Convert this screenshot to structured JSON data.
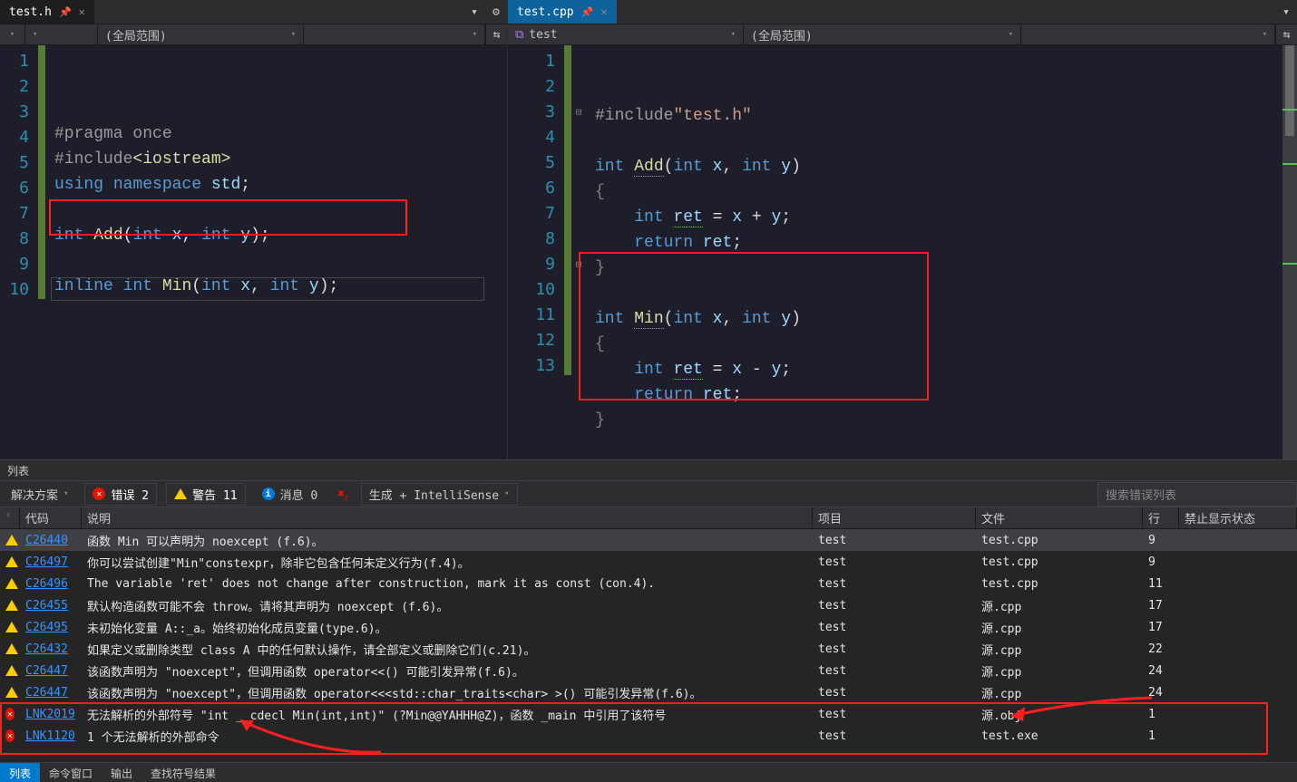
{
  "left_tab": {
    "name": "test.h",
    "pin": "⇲"
  },
  "right_tab": {
    "name": "test.cpp",
    "pin": "⇲"
  },
  "left_nav": {
    "scope": "(全局范围)"
  },
  "right_nav": {
    "proj_icon": "⧉",
    "proj": "test",
    "scope": "(全局范围)"
  },
  "left_code": {
    "lines": [
      {
        "n": "1",
        "tokens": [
          [
            "directive",
            "#pragma once"
          ]
        ]
      },
      {
        "n": "2",
        "tokens": [
          [
            "directive",
            "#include"
          ],
          [
            "ident",
            "<iostream>"
          ]
        ]
      },
      {
        "n": "3",
        "tokens": [
          [
            "kw",
            "using "
          ],
          [
            "kw",
            "namespace "
          ],
          [
            "var",
            "std"
          ],
          [
            "punct",
            ";"
          ]
        ]
      },
      {
        "n": "4",
        "tokens": []
      },
      {
        "n": "5",
        "tokens": [
          [
            "type",
            "int "
          ],
          [
            "ident",
            "Add"
          ],
          [
            "paren",
            "("
          ],
          [
            "type",
            "int "
          ],
          [
            "var",
            "x"
          ],
          [
            "punct",
            ", "
          ],
          [
            "type",
            "int "
          ],
          [
            "var",
            "y"
          ],
          [
            "paren",
            ")"
          ],
          [
            "punct",
            ";"
          ]
        ]
      },
      {
        "n": "6",
        "tokens": []
      },
      {
        "n": "7",
        "tokens": [
          [
            "kw",
            "inline "
          ],
          [
            "type",
            "int "
          ],
          [
            "ident",
            "Min"
          ],
          [
            "paren",
            "("
          ],
          [
            "type",
            "int "
          ],
          [
            "var",
            "x"
          ],
          [
            "punct",
            ", "
          ],
          [
            "type",
            "int "
          ],
          [
            "var",
            "y"
          ],
          [
            "paren",
            ")"
          ],
          [
            "punct",
            ";"
          ]
        ]
      },
      {
        "n": "8",
        "tokens": []
      },
      {
        "n": "9",
        "tokens": []
      },
      {
        "n": "10",
        "tokens": []
      }
    ]
  },
  "right_code": {
    "lines": [
      {
        "n": "1",
        "tokens": [
          [
            "directive",
            "#include"
          ],
          [
            "str",
            "\"test.h\""
          ]
        ]
      },
      {
        "n": "2",
        "tokens": []
      },
      {
        "n": "3",
        "fold": "⊟",
        "tokens": [
          [
            "type",
            "int "
          ],
          [
            "ident",
            "Add",
            "squig"
          ],
          [
            "paren",
            "("
          ],
          [
            "type",
            "int "
          ],
          [
            "var",
            "x"
          ],
          [
            "punct",
            ", "
          ],
          [
            "type",
            "int "
          ],
          [
            "var",
            "y"
          ],
          [
            "paren",
            ")"
          ]
        ]
      },
      {
        "n": "4",
        "tokens": [
          [
            "gray",
            "{"
          ]
        ]
      },
      {
        "n": "5",
        "tokens": [
          [
            "punct",
            "    "
          ],
          [
            "type",
            "int "
          ],
          [
            "var",
            "ret",
            "squig"
          ],
          [
            "punct",
            " = "
          ],
          [
            "var",
            "x"
          ],
          [
            "punct",
            " + "
          ],
          [
            "var",
            "y"
          ],
          [
            "punct",
            ";"
          ]
        ]
      },
      {
        "n": "6",
        "tokens": [
          [
            "punct",
            "    "
          ],
          [
            "kw",
            "return "
          ],
          [
            "var",
            "ret"
          ],
          [
            "punct",
            ";"
          ]
        ]
      },
      {
        "n": "7",
        "tokens": [
          [
            "gray",
            "}"
          ]
        ]
      },
      {
        "n": "8",
        "tokens": []
      },
      {
        "n": "9",
        "fold": "⊟",
        "tokens": [
          [
            "type",
            "int "
          ],
          [
            "ident",
            "Min",
            "squig"
          ],
          [
            "paren",
            "("
          ],
          [
            "type",
            "int "
          ],
          [
            "var",
            "x"
          ],
          [
            "punct",
            ", "
          ],
          [
            "type",
            "int "
          ],
          [
            "var",
            "y"
          ],
          [
            "paren",
            ")"
          ]
        ]
      },
      {
        "n": "10",
        "tokens": [
          [
            "gray",
            "{"
          ]
        ]
      },
      {
        "n": "11",
        "tokens": [
          [
            "punct",
            "    "
          ],
          [
            "type",
            "int "
          ],
          [
            "var",
            "ret",
            "squig"
          ],
          [
            "punct",
            " = "
          ],
          [
            "var",
            "x"
          ],
          [
            "punct",
            " - "
          ],
          [
            "var",
            "y"
          ],
          [
            "punct",
            ";"
          ]
        ]
      },
      {
        "n": "12",
        "tokens": [
          [
            "punct",
            "    "
          ],
          [
            "kw",
            "return "
          ],
          [
            "var",
            "ret"
          ],
          [
            "punct",
            ";"
          ]
        ]
      },
      {
        "n": "13",
        "tokens": [
          [
            "gray",
            "}"
          ]
        ]
      }
    ]
  },
  "error_panel_title": "列表",
  "toolbar": {
    "solution": "解决方案",
    "errors": "错误 2",
    "warnings": "警告 11",
    "messages": "消息 0",
    "build": "生成 + IntelliSense",
    "search_placeholder": "搜索错误列表"
  },
  "headers": {
    "code": "代码",
    "desc": "说明",
    "proj": "项目",
    "file": "文件",
    "line": "行",
    "supp": "禁止显示状态"
  },
  "errors": [
    {
      "sev": "warn",
      "code": "C26440",
      "desc": "函数 Min 可以声明为 noexcept (f.6)。",
      "proj": "test",
      "file": "test.cpp",
      "line": "9",
      "sel": true
    },
    {
      "sev": "warn",
      "code": "C26497",
      "desc": "你可以尝试创建\"Min\"constexpr，除非它包含任何未定义行为(f.4)。",
      "proj": "test",
      "file": "test.cpp",
      "line": "9"
    },
    {
      "sev": "warn",
      "code": "C26496",
      "desc": "The variable 'ret' does not change after construction, mark it as const (con.4).",
      "proj": "test",
      "file": "test.cpp",
      "line": "11"
    },
    {
      "sev": "warn",
      "code": "C26455",
      "desc": "默认构造函数可能不会 throw。请将其声明为 noexcept (f.6)。",
      "proj": "test",
      "file": "源.cpp",
      "line": "17"
    },
    {
      "sev": "warn",
      "code": "C26495",
      "desc": "未初始化变量 A::_a。始终初始化成员变量(type.6)。",
      "proj": "test",
      "file": "源.cpp",
      "line": "17"
    },
    {
      "sev": "warn",
      "code": "C26432",
      "desc": "如果定义或删除类型 class A 中的任何默认操作，请全部定义或删除它们(c.21)。",
      "proj": "test",
      "file": "源.cpp",
      "line": "22"
    },
    {
      "sev": "warn",
      "code": "C26447",
      "desc": "该函数声明为 \"noexcept\"，但调用函数 operator<<() 可能引发异常(f.6)。",
      "proj": "test",
      "file": "源.cpp",
      "line": "24"
    },
    {
      "sev": "warn",
      "code": "C26447",
      "desc": "该函数声明为 \"noexcept\"，但调用函数 operator<<<std::char_traits<char> >() 可能引发异常(f.6)。",
      "proj": "test",
      "file": "源.cpp",
      "line": "24"
    },
    {
      "sev": "err",
      "code": "LNK2019",
      "desc": "无法解析的外部符号 \"int __cdecl Min(int,int)\" (?Min@@YAHHH@Z)，函数 _main 中引用了该符号",
      "proj": "test",
      "file": "源.obj",
      "line": "1"
    },
    {
      "sev": "err",
      "code": "LNK1120",
      "desc": "1 个无法解析的外部命令",
      "proj": "test",
      "file": "test.exe",
      "line": "1"
    }
  ],
  "bottom_tabs": [
    "列表",
    "命令窗口",
    "输出",
    "查找符号结果"
  ]
}
